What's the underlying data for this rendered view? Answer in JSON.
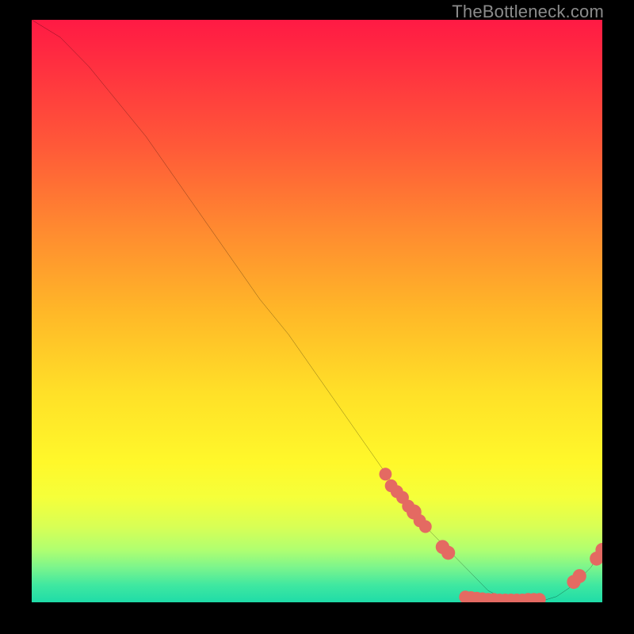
{
  "watermark": "TheBottleneck.com",
  "chart_data": {
    "type": "line",
    "title": "",
    "xlabel": "",
    "ylabel": "",
    "xlim": [
      0,
      100
    ],
    "ylim": [
      0,
      100
    ],
    "grid": false,
    "legend": false,
    "series": [
      {
        "name": "curve",
        "x": [
          0,
          5,
          10,
          15,
          20,
          25,
          30,
          35,
          40,
          45,
          50,
          55,
          60,
          65,
          70,
          72,
          75,
          78,
          80,
          82,
          85,
          88,
          90,
          92,
          95,
          98,
          100
        ],
        "y": [
          100,
          97,
          92,
          86,
          80,
          73,
          66,
          59,
          52,
          46,
          39,
          32,
          25,
          18,
          12,
          10,
          7,
          4,
          2,
          1,
          0.5,
          0.3,
          0.4,
          1,
          3,
          6,
          9
        ]
      }
    ],
    "markers": [
      {
        "x": 62,
        "y": 22,
        "r": 1.1
      },
      {
        "x": 63,
        "y": 20,
        "r": 1.1
      },
      {
        "x": 64,
        "y": 19,
        "r": 1.1
      },
      {
        "x": 65,
        "y": 18,
        "r": 1.1
      },
      {
        "x": 66,
        "y": 16.5,
        "r": 1.1
      },
      {
        "x": 67,
        "y": 15.5,
        "r": 1.3
      },
      {
        "x": 68,
        "y": 14,
        "r": 1.1
      },
      {
        "x": 69,
        "y": 13,
        "r": 1.1
      },
      {
        "x": 72,
        "y": 9.5,
        "r": 1.2
      },
      {
        "x": 73,
        "y": 8.5,
        "r": 1.2
      },
      {
        "x": 76,
        "y": 0.9,
        "r": 1.1
      },
      {
        "x": 77,
        "y": 0.8,
        "r": 1.1
      },
      {
        "x": 78,
        "y": 0.7,
        "r": 1.1
      },
      {
        "x": 79,
        "y": 0.6,
        "r": 1.1
      },
      {
        "x": 80,
        "y": 0.5,
        "r": 1.1
      },
      {
        "x": 81,
        "y": 0.5,
        "r": 1.1
      },
      {
        "x": 82,
        "y": 0.4,
        "r": 1.1
      },
      {
        "x": 83,
        "y": 0.4,
        "r": 1.1
      },
      {
        "x": 84,
        "y": 0.4,
        "r": 1.1
      },
      {
        "x": 85,
        "y": 0.4,
        "r": 1.1
      },
      {
        "x": 86,
        "y": 0.4,
        "r": 1.1
      },
      {
        "x": 87,
        "y": 0.5,
        "r": 1.1
      },
      {
        "x": 88,
        "y": 0.5,
        "r": 1.1
      },
      {
        "x": 89,
        "y": 0.5,
        "r": 1.1
      },
      {
        "x": 95,
        "y": 3.5,
        "r": 1.2
      },
      {
        "x": 96,
        "y": 4.5,
        "r": 1.2
      },
      {
        "x": 99,
        "y": 7.5,
        "r": 1.2
      },
      {
        "x": 100,
        "y": 9.0,
        "r": 1.2
      }
    ],
    "colors": {
      "curve": "#000000",
      "marker": "#e46a62"
    },
    "background_gradient": {
      "top": "#ff1a44",
      "mid": "#ffe028",
      "bottom": "#1fdca8"
    }
  }
}
